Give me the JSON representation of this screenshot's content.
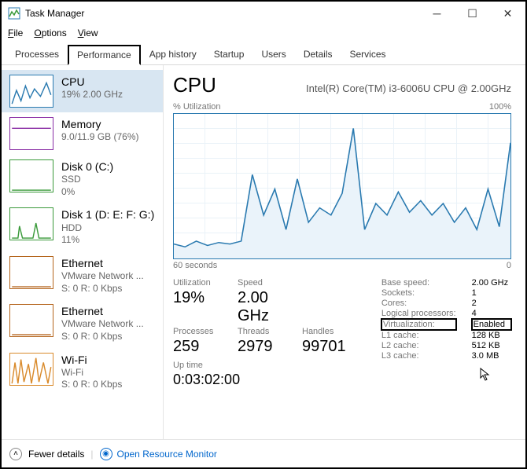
{
  "window": {
    "title": "Task Manager"
  },
  "menu": {
    "file": "File",
    "options": "Options",
    "view": "View"
  },
  "tabs": [
    "Processes",
    "Performance",
    "App history",
    "Startup",
    "Users",
    "Details",
    "Services"
  ],
  "active_tab": 1,
  "sidebar": [
    {
      "name": "CPU",
      "l1": "19% 2.00 GHz",
      "l2": "",
      "color": "#2a7ab0"
    },
    {
      "name": "Memory",
      "l1": "9.0/11.9 GB (76%)",
      "l2": "",
      "color": "#8a2da5"
    },
    {
      "name": "Disk 0 (C:)",
      "l1": "SSD",
      "l2": "0%",
      "color": "#3a9a3a"
    },
    {
      "name": "Disk 1 (D: E: F: G:)",
      "l1": "HDD",
      "l2": "11%",
      "color": "#3a9a3a"
    },
    {
      "name": "Ethernet",
      "l1": "VMware Network ...",
      "l2": "S: 0 R: 0 Kbps",
      "color": "#b5651d"
    },
    {
      "name": "Ethernet",
      "l1": "VMware Network ...",
      "l2": "S: 0 R: 0 Kbps",
      "color": "#b5651d"
    },
    {
      "name": "Wi-Fi",
      "l1": "Wi-Fi",
      "l2": "S: 0 R: 0 Kbps",
      "color": "#d98a2b"
    }
  ],
  "main": {
    "title": "CPU",
    "subtitle": "Intel(R) Core(TM) i3-6006U CPU @ 2.00GHz",
    "chart_top_left": "% Utilization",
    "chart_top_right": "100%",
    "chart_bottom_left": "60 seconds",
    "chart_bottom_right": "0",
    "stats": {
      "util_label": "Utilization",
      "util": "19%",
      "speed_label": "Speed",
      "speed": "2.00 GHz",
      "procs_label": "Processes",
      "procs": "259",
      "threads_label": "Threads",
      "threads": "2979",
      "handles_label": "Handles",
      "handles": "99701",
      "uptime_label": "Up time",
      "uptime": "0:03:02:00"
    },
    "right": [
      [
        "Base speed:",
        "2.00 GHz"
      ],
      [
        "Sockets:",
        "1"
      ],
      [
        "Cores:",
        "2"
      ],
      [
        "Logical processors:",
        "4"
      ],
      [
        "Virtualization:",
        "Enabled"
      ],
      [
        "L1 cache:",
        "128 KB"
      ],
      [
        "L2 cache:",
        "512 KB"
      ],
      [
        "L3 cache:",
        "3.0 MB"
      ]
    ]
  },
  "footer": {
    "fewer": "Fewer details",
    "orm": "Open Resource Monitor"
  },
  "chart_data": {
    "type": "line",
    "title": "% Utilization",
    "xlabel": "60 seconds → 0",
    "ylabel": "% Utilization",
    "ylim": [
      0,
      100
    ],
    "x_seconds_ago": [
      60,
      58,
      56,
      54,
      52,
      50,
      48,
      46,
      44,
      42,
      40,
      38,
      36,
      34,
      32,
      30,
      28,
      26,
      24,
      22,
      20,
      18,
      16,
      14,
      12,
      10,
      8,
      6,
      4,
      2,
      0
    ],
    "values": [
      10,
      8,
      12,
      9,
      11,
      10,
      12,
      58,
      30,
      48,
      20,
      55,
      25,
      35,
      30,
      45,
      90,
      20,
      38,
      30,
      46,
      32,
      40,
      30,
      38,
      25,
      35,
      20,
      48,
      22,
      80
    ]
  }
}
